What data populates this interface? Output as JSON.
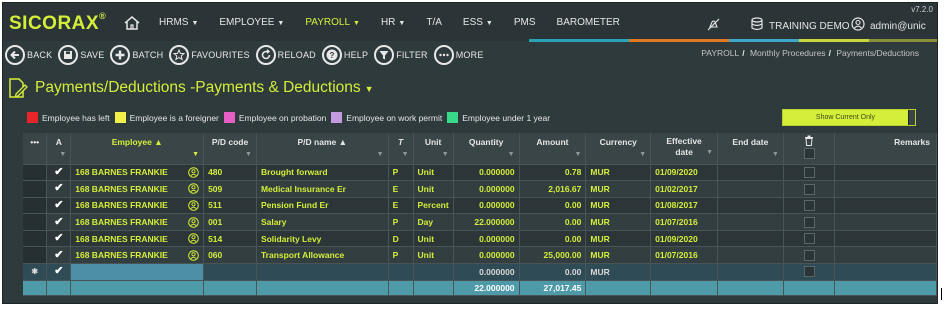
{
  "app": {
    "logo": "SICORAX",
    "logo_mark": "®",
    "version": "v7.2.0",
    "company": "TRAINING DEMO",
    "user": "admin@unic"
  },
  "nav": {
    "items": [
      {
        "label": "HRMS",
        "caret": "▼",
        "active": false
      },
      {
        "label": "EMPLOYEE",
        "caret": "▼",
        "active": false
      },
      {
        "label": "PAYROLL",
        "caret": "▼",
        "active": true
      },
      {
        "label": "HR",
        "caret": "▼",
        "active": false
      },
      {
        "label": "T/A",
        "caret": "",
        "active": false
      },
      {
        "label": "ESS",
        "caret": "▼",
        "active": false
      },
      {
        "label": "PMS",
        "caret": "",
        "active": false
      },
      {
        "label": "BAROMETER",
        "caret": "",
        "active": false
      }
    ],
    "colorbars": [
      {
        "color": "#2aa3b8"
      },
      {
        "color": "#e07a22"
      },
      {
        "color": "#3fa7c9"
      },
      {
        "color": "#c9d63a"
      },
      {
        "color": "#8a8f3a"
      }
    ]
  },
  "toolbar": {
    "back": "BACK",
    "save": "SAVE",
    "batch": "BATCH",
    "favourites": "FAVOURITES",
    "reload": "RELOAD",
    "help": "HELP",
    "filter": "FILTER",
    "more": "MORE"
  },
  "breadcrumb": {
    "items": [
      "PAYROLL",
      "Monthly Procedures",
      "Payments/Deductions"
    ],
    "separator": "/"
  },
  "page": {
    "title": "Payments/Deductions -Payments & Deductions",
    "title_caret": "▼"
  },
  "legend": [
    {
      "label": "Employee has left",
      "color": "#e8262a"
    },
    {
      "label": "Employee is a foreigner",
      "color": "#f3f04a"
    },
    {
      "label": "Employee on probation",
      "color": "#e65fc4"
    },
    {
      "label": "Employee on work permit",
      "color": "#c49be0"
    },
    {
      "label": "Employee under 1 year",
      "color": "#39d98a"
    }
  ],
  "toggle": {
    "label": "Show Current Only"
  },
  "grid": {
    "columns": {
      "dots": "•••",
      "a": "A",
      "employee": "Employee ▲",
      "pd_code": "P/D code",
      "pd_name": "P/D name ▲",
      "t": "T",
      "unit": "Unit",
      "quantity": "Quantity",
      "amount": "Amount",
      "currency": "Currency",
      "effective": "Effective date",
      "end": "End date",
      "remarks": "Remarks"
    },
    "rows": [
      {
        "employee": "168 BARNES FRANKIE",
        "code": "480",
        "name": "Brought forward",
        "t": "P",
        "unit": "Unit",
        "qty": "0.000000",
        "amount": "0.78",
        "currency": "MUR",
        "effective": "01/09/2020",
        "end": "",
        "remarks": ""
      },
      {
        "employee": "168 BARNES FRANKIE",
        "code": "509",
        "name": "Medical Insurance Er",
        "t": "E",
        "unit": "Unit",
        "qty": "0.000000",
        "amount": "2,016.67",
        "currency": "MUR",
        "effective": "01/02/2017",
        "end": "",
        "remarks": ""
      },
      {
        "employee": "168 BARNES FRANKIE",
        "code": "511",
        "name": "Pension Fund Er",
        "t": "E",
        "unit": "Percent",
        "qty": "0.000000",
        "amount": "0.00",
        "currency": "MUR",
        "effective": "01/08/2017",
        "end": "",
        "remarks": ""
      },
      {
        "employee": "168 BARNES FRANKIE",
        "code": "001",
        "name": "Salary",
        "t": "P",
        "unit": "Day",
        "qty": "22.000000",
        "amount": "0.00",
        "currency": "MUR",
        "effective": "01/07/2016",
        "end": "",
        "remarks": ""
      },
      {
        "employee": "168 BARNES FRANKIE",
        "code": "514",
        "name": "Solidarity Levy",
        "t": "D",
        "unit": "Unit",
        "qty": "0.000000",
        "amount": "0.00",
        "currency": "MUR",
        "effective": "01/09/2020",
        "end": "",
        "remarks": ""
      },
      {
        "employee": "168 BARNES FRANKIE",
        "code": "060",
        "name": "Transport Allowance",
        "t": "P",
        "unit": "Unit",
        "qty": "0.000000",
        "amount": "25,000.00",
        "currency": "MUR",
        "effective": "01/07/2016",
        "end": "",
        "remarks": ""
      }
    ],
    "new_row": {
      "marker": "✱",
      "qty": "0.000000",
      "amount": "0.00",
      "currency": "MUR"
    },
    "totals": {
      "qty": "22.000000",
      "amount": "27,017.45"
    }
  }
}
